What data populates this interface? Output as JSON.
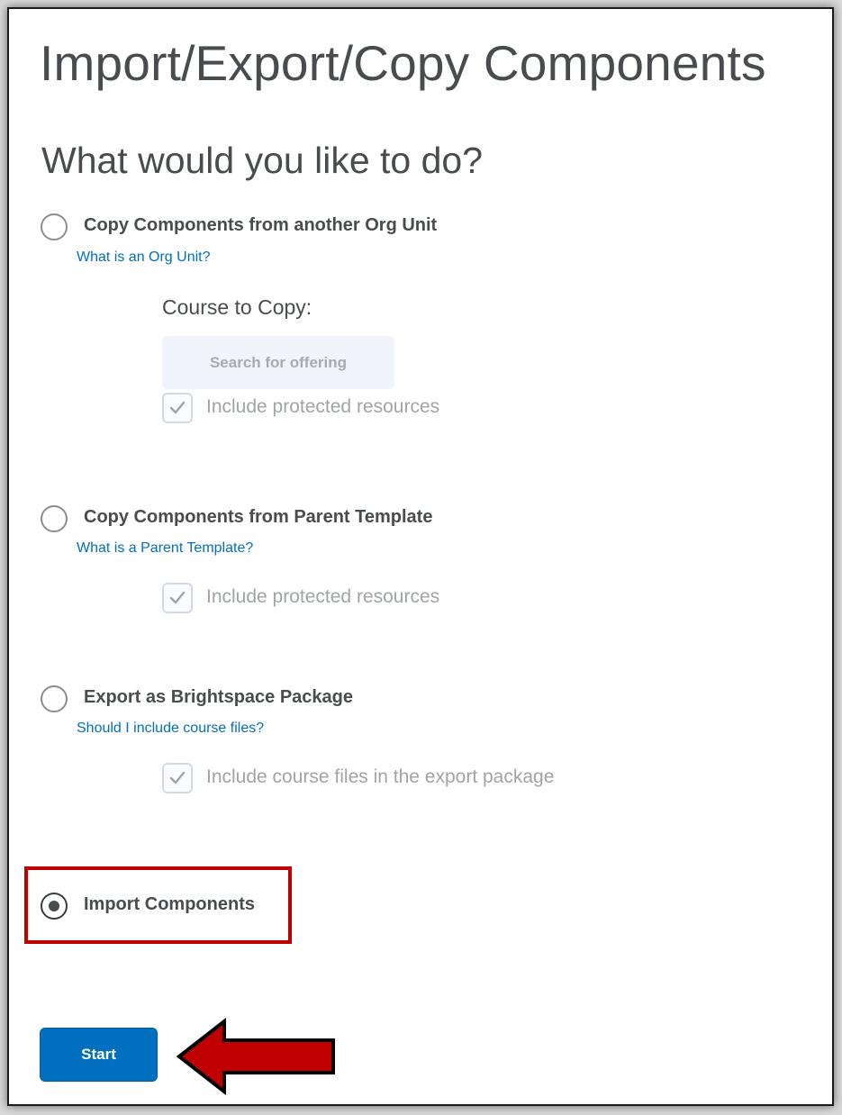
{
  "page": {
    "title": "Import/Export/Copy Components",
    "question": "What would you like to do?"
  },
  "options": [
    {
      "label": "Copy Components from another Org Unit",
      "help_link": "What is an Org Unit?",
      "selected": false,
      "course_to_copy": {
        "heading": "Course to Copy:",
        "search_placeholder": "Search for offering"
      },
      "checkbox_label": "Include protected resources",
      "checkbox_checked": true
    },
    {
      "label": "Copy Components from Parent Template",
      "help_link": "What is a Parent Template?",
      "selected": false,
      "checkbox_label": "Include protected resources",
      "checkbox_checked": true
    },
    {
      "label": "Export as Brightspace Package",
      "help_link": "Should I include course files?",
      "selected": false,
      "checkbox_label": "Include course files in the export package",
      "checkbox_checked": true
    },
    {
      "label": "Import Components",
      "selected": true
    }
  ],
  "actions": {
    "start_label": "Start"
  },
  "annotations": {
    "highlight_color": "#c00000",
    "arrow_color": "#c00000",
    "arrow_points_to": "start-button"
  },
  "colors": {
    "primary": "#006fbf",
    "text": "#494c4e",
    "disabled_text": "#a0a4a7"
  }
}
